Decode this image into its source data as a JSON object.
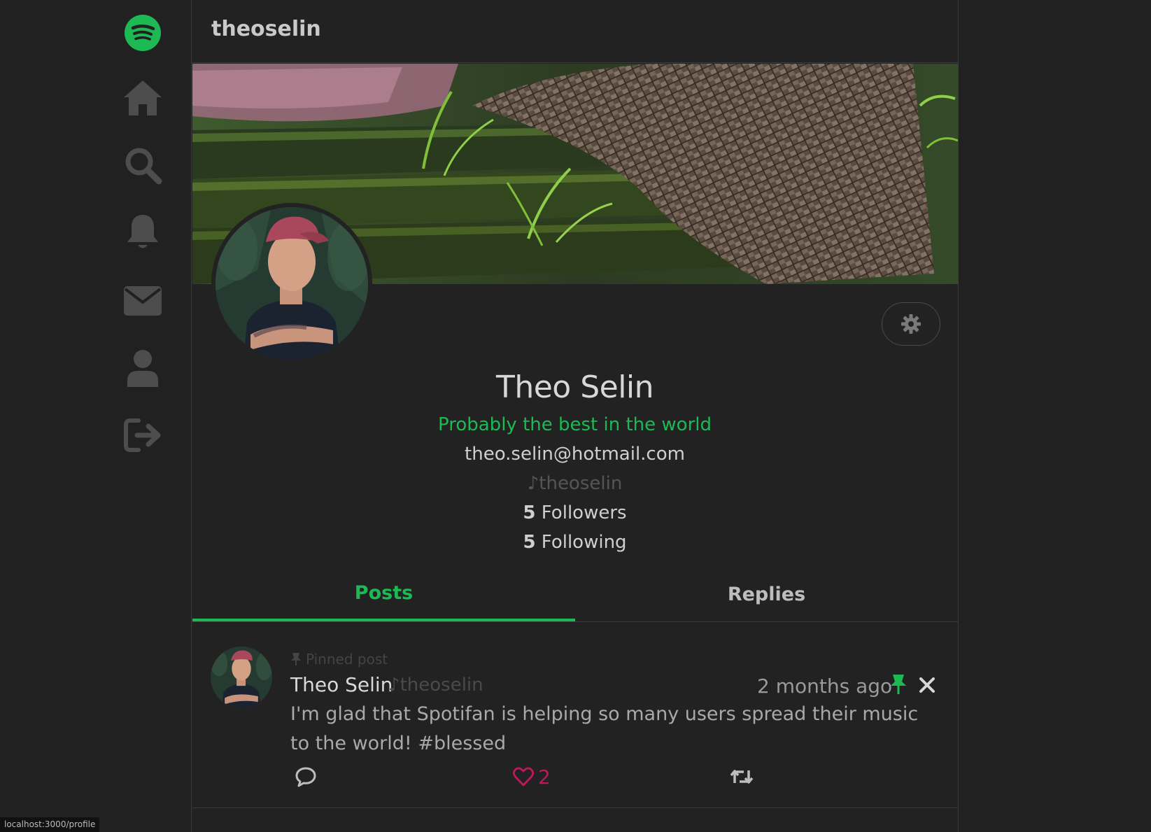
{
  "nav": {
    "items": [
      {
        "icon": "spotify-logo-icon"
      },
      {
        "icon": "home-icon"
      },
      {
        "icon": "search-icon"
      },
      {
        "icon": "bell-icon"
      },
      {
        "icon": "mail-icon"
      },
      {
        "icon": "user-icon"
      },
      {
        "icon": "logout-icon"
      }
    ],
    "accent": "#1db954"
  },
  "header": {
    "title": "theoselin"
  },
  "profile": {
    "name": "Theo Selin",
    "bio": "Probably the best in the world",
    "email": "theo.selin@hotmail.com",
    "handle": "♪theoselin",
    "followers_count": "5",
    "followers_label": "Followers",
    "following_count": "5",
    "following_label": "Following"
  },
  "tabs": [
    {
      "label": "Posts",
      "active": true
    },
    {
      "label": "Replies",
      "active": false
    }
  ],
  "post": {
    "pinned_label": "Pinned post",
    "author_name": "Theo Selin",
    "author_handle": "♪theoselin",
    "time": "2 months ago",
    "text": "I'm glad that Spotifan is helping so many users spread their music to the world! #blessed",
    "likes": "2"
  },
  "status_bar": {
    "url": "localhost:3000/profile"
  },
  "colors": {
    "background": "#212121",
    "accent": "#1db954",
    "like": "#c2185b"
  }
}
